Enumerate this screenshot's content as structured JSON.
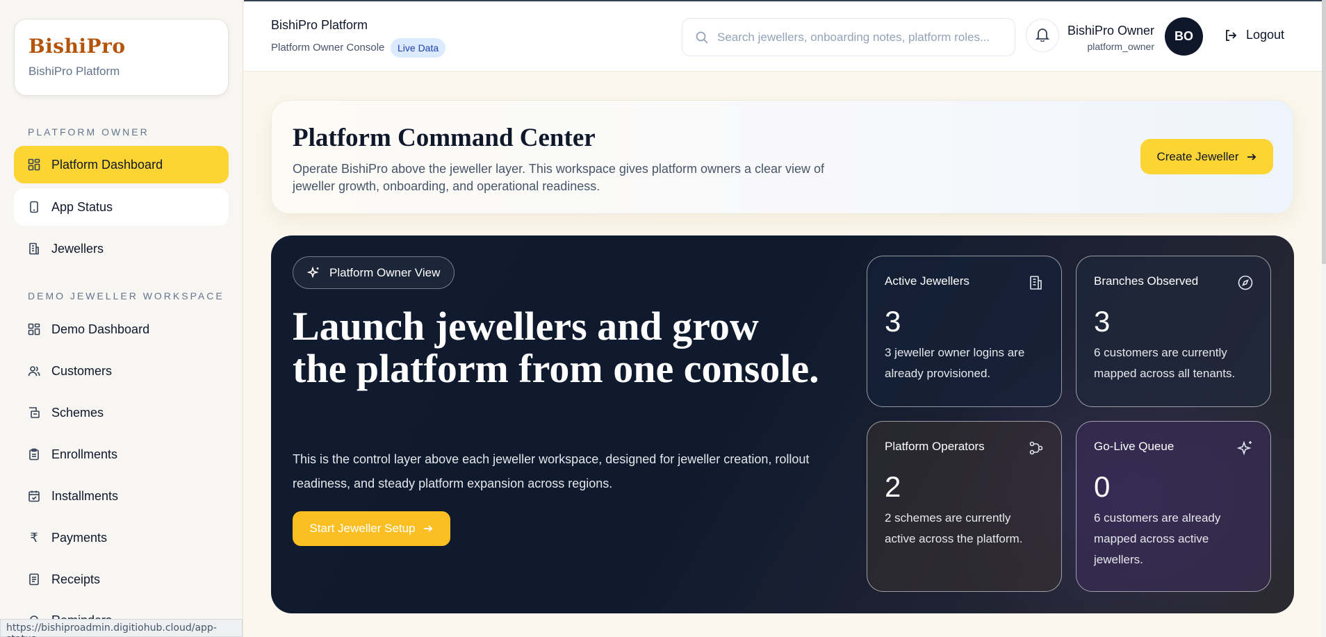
{
  "brand": {
    "name": "BishiPro",
    "subtitle": "BishiPro Platform"
  },
  "sidebar": {
    "section_owner": "PLATFORM OWNER",
    "owner_items": [
      {
        "label": "Platform Dashboard",
        "icon": "grid-icon",
        "active": true
      },
      {
        "label": "App Status",
        "icon": "phone-icon"
      },
      {
        "label": "Jewellers",
        "icon": "building-icon"
      }
    ],
    "section_demo": "DEMO JEWELLER WORKSPACE",
    "demo_items": [
      {
        "label": "Demo Dashboard",
        "icon": "grid-icon"
      },
      {
        "label": "Customers",
        "icon": "users-icon"
      },
      {
        "label": "Schemes",
        "icon": "scheme-icon"
      },
      {
        "label": "Enrollments",
        "icon": "clipboard-icon"
      },
      {
        "label": "Installments",
        "icon": "calendar-check-icon"
      },
      {
        "label": "Payments",
        "icon": "rupee-icon"
      },
      {
        "label": "Receipts",
        "icon": "receipt-icon"
      },
      {
        "label": "Reminders",
        "icon": "bell-icon"
      }
    ],
    "status_url": "https://bishiproadmin.digitiohub.cloud/app-status"
  },
  "header": {
    "title": "BishiPro Platform",
    "subtitle": "Platform Owner Console",
    "badge": "Live Data",
    "search_placeholder": "Search jewellers, onboarding notes, platform roles...",
    "user_name": "BishiPro Owner",
    "user_role": "platform_owner",
    "avatar_initials": "BO",
    "logout_label": "Logout"
  },
  "command": {
    "title": "Platform Command Center",
    "description": "Operate BishiPro above the jeweller layer. This workspace gives platform owners a clear view of jeweller growth, onboarding, and operational readiness.",
    "create_label": "Create Jeweller"
  },
  "hero": {
    "chip": "Platform Owner View",
    "title": "Launch jewellers and grow the platform from one console.",
    "description": "This is the control layer above each jeweller workspace, designed for jeweller creation, rollout readiness, and steady platform expansion across regions.",
    "cta": "Start Jeweller Setup"
  },
  "stats": [
    {
      "label": "Active Jewellers",
      "value": "3",
      "note": "3 jeweller owner logins are already provisioned.",
      "icon": "building-icon"
    },
    {
      "label": "Branches Observed",
      "value": "3",
      "note": "6 customers are currently mapped across all tenants.",
      "icon": "compass-icon"
    },
    {
      "label": "Platform Operators",
      "value": "2",
      "note": "2 schemes are currently active across the platform.",
      "icon": "workflow-icon"
    },
    {
      "label": "Go-Live Queue",
      "value": "0",
      "note": "6 customers are already mapped across active jewellers.",
      "icon": "sparkles-icon"
    }
  ],
  "colors": {
    "accent": "#fcd535",
    "brand": "#b45309",
    "hero_bg": "#111b2f",
    "cta": "#fbbf24"
  }
}
